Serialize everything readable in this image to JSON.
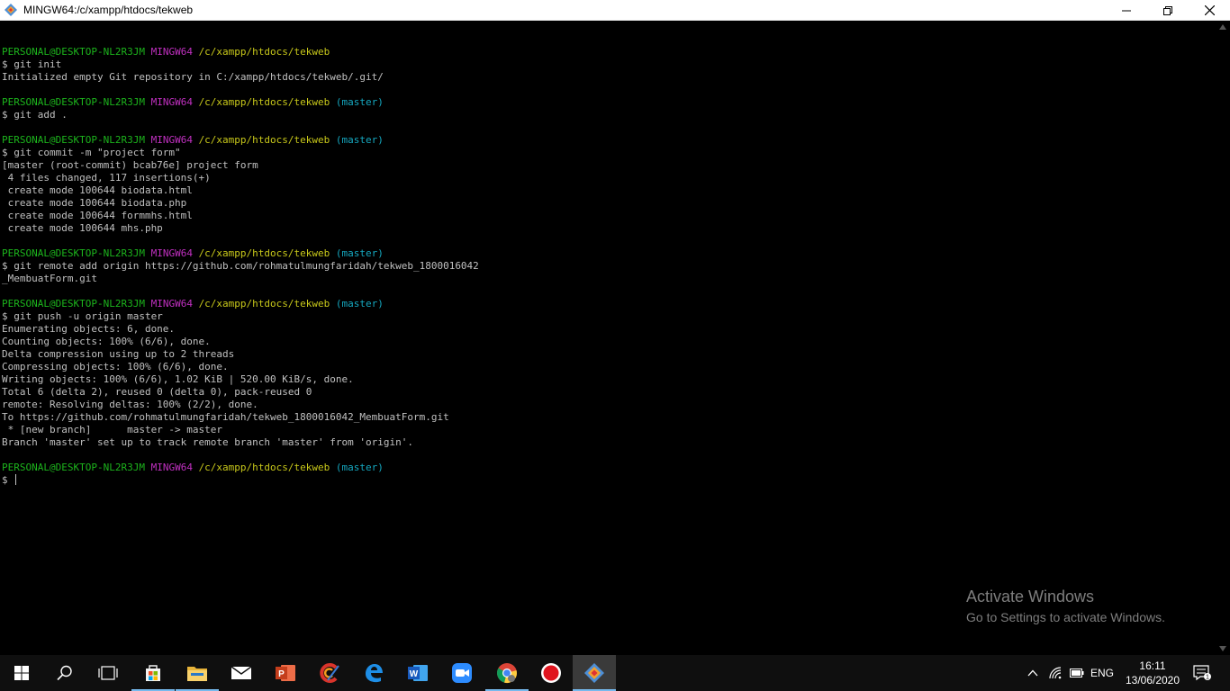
{
  "window": {
    "title": "MINGW64:/c/xampp/htdocs/tekweb"
  },
  "terminal": {
    "lines": [
      {
        "type": "blank"
      },
      {
        "type": "prompt",
        "user": "PERSONAL@DESKTOP-NL2R3JM",
        "host": "MINGW64",
        "path": "/c/xampp/htdocs/tekweb",
        "branch": ""
      },
      {
        "type": "text",
        "text": "$ git init"
      },
      {
        "type": "text",
        "text": "Initialized empty Git repository in C:/xampp/htdocs/tekweb/.git/"
      },
      {
        "type": "blank"
      },
      {
        "type": "prompt",
        "user": "PERSONAL@DESKTOP-NL2R3JM",
        "host": "MINGW64",
        "path": "/c/xampp/htdocs/tekweb",
        "branch": "(master)"
      },
      {
        "type": "text",
        "text": "$ git add ."
      },
      {
        "type": "blank"
      },
      {
        "type": "prompt",
        "user": "PERSONAL@DESKTOP-NL2R3JM",
        "host": "MINGW64",
        "path": "/c/xampp/htdocs/tekweb",
        "branch": "(master)"
      },
      {
        "type": "text",
        "text": "$ git commit -m \"project form\""
      },
      {
        "type": "text",
        "text": "[master (root-commit) bcab76e] project form"
      },
      {
        "type": "text",
        "text": " 4 files changed, 117 insertions(+)"
      },
      {
        "type": "text",
        "text": " create mode 100644 biodata.html"
      },
      {
        "type": "text",
        "text": " create mode 100644 biodata.php"
      },
      {
        "type": "text",
        "text": " create mode 100644 formmhs.html"
      },
      {
        "type": "text",
        "text": " create mode 100644 mhs.php"
      },
      {
        "type": "blank"
      },
      {
        "type": "prompt",
        "user": "PERSONAL@DESKTOP-NL2R3JM",
        "host": "MINGW64",
        "path": "/c/xampp/htdocs/tekweb",
        "branch": "(master)"
      },
      {
        "type": "text",
        "text": "$ git remote add origin https://github.com/rohmatulmungfaridah/tekweb_1800016042"
      },
      {
        "type": "text",
        "text": "_MembuatForm.git"
      },
      {
        "type": "blank"
      },
      {
        "type": "prompt",
        "user": "PERSONAL@DESKTOP-NL2R3JM",
        "host": "MINGW64",
        "path": "/c/xampp/htdocs/tekweb",
        "branch": "(master)"
      },
      {
        "type": "text",
        "text": "$ git push -u origin master"
      },
      {
        "type": "text",
        "text": "Enumerating objects: 6, done."
      },
      {
        "type": "text",
        "text": "Counting objects: 100% (6/6), done."
      },
      {
        "type": "text",
        "text": "Delta compression using up to 2 threads"
      },
      {
        "type": "text",
        "text": "Compressing objects: 100% (6/6), done."
      },
      {
        "type": "text",
        "text": "Writing objects: 100% (6/6), 1.02 KiB | 520.00 KiB/s, done."
      },
      {
        "type": "text",
        "text": "Total 6 (delta 2), reused 0 (delta 0), pack-reused 0"
      },
      {
        "type": "text",
        "text": "remote: Resolving deltas: 100% (2/2), done."
      },
      {
        "type": "text",
        "text": "To https://github.com/rohmatulmungfaridah/tekweb_1800016042_MembuatForm.git"
      },
      {
        "type": "text",
        "text": " * [new branch]      master -> master"
      },
      {
        "type": "text",
        "text": "Branch 'master' set up to track remote branch 'master' from 'origin'."
      },
      {
        "type": "blank"
      },
      {
        "type": "prompt",
        "user": "PERSONAL@DESKTOP-NL2R3JM",
        "host": "MINGW64",
        "path": "/c/xampp/htdocs/tekweb",
        "branch": "(master)"
      },
      {
        "type": "input",
        "text": "$ "
      }
    ]
  },
  "watermark": {
    "line1": "Activate Windows",
    "line2": "Go to Settings to activate Windows."
  },
  "taskbar": {
    "language": "ENG",
    "time": "16:11",
    "date": "13/06/2020",
    "notification_count": "1"
  },
  "colors": {
    "user": "#1cb41c",
    "host": "#c030c0",
    "path": "#c8c81a",
    "branch": "#15a8c0",
    "accent": "#76b9ed"
  }
}
